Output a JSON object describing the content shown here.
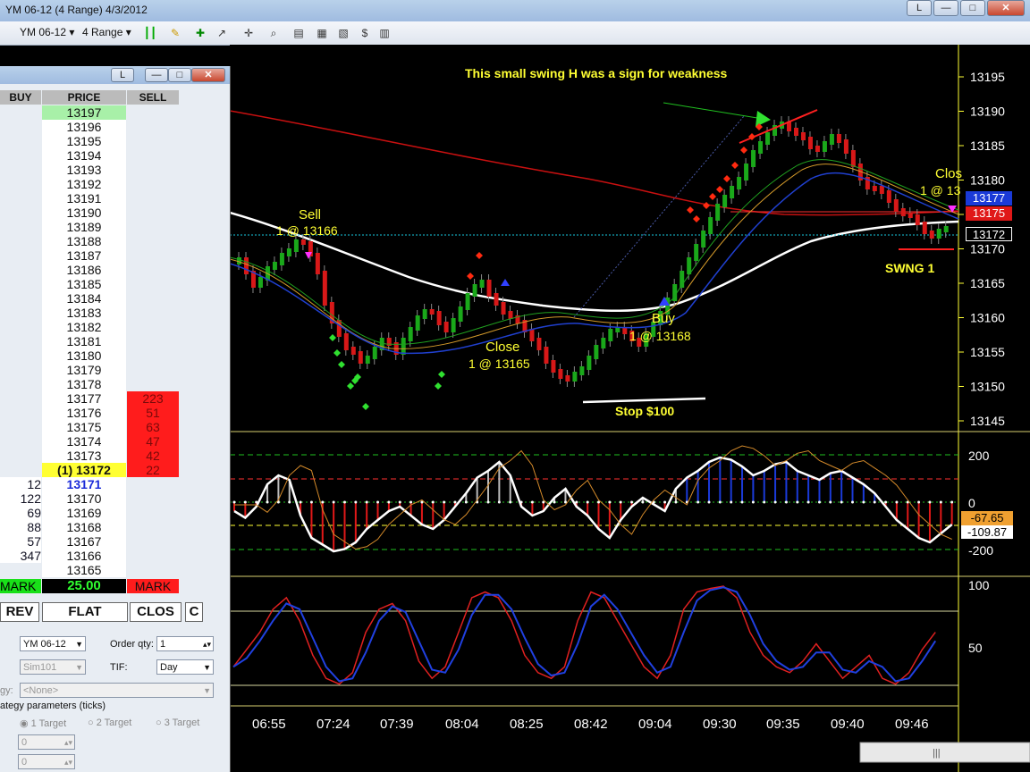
{
  "window": {
    "title": "YM 06-12 (4 Range)  4/3/2012",
    "btn_restore": "L",
    "btn_min": "—",
    "btn_max": "□",
    "btn_close": "✕"
  },
  "toolbar": {
    "instrument": "YM 06-12",
    "period": "4 Range"
  },
  "dom": {
    "title_btn": "L",
    "headers": {
      "buy": "BUY",
      "price": "PRICE",
      "sell": "SELL"
    },
    "rows": [
      {
        "price": "13197",
        "buy": "",
        "sell": ""
      },
      {
        "price": "13196",
        "buy": "",
        "sell": ""
      },
      {
        "price": "13195",
        "buy": "",
        "sell": ""
      },
      {
        "price": "13194",
        "buy": "",
        "sell": ""
      },
      {
        "price": "13193",
        "buy": "",
        "sell": ""
      },
      {
        "price": "13192",
        "buy": "",
        "sell": ""
      },
      {
        "price": "13191",
        "buy": "",
        "sell": ""
      },
      {
        "price": "13190",
        "buy": "",
        "sell": ""
      },
      {
        "price": "13189",
        "buy": "",
        "sell": ""
      },
      {
        "price": "13188",
        "buy": "",
        "sell": ""
      },
      {
        "price": "13187",
        "buy": "",
        "sell": ""
      },
      {
        "price": "13186",
        "buy": "",
        "sell": ""
      },
      {
        "price": "13185",
        "buy": "",
        "sell": ""
      },
      {
        "price": "13184",
        "buy": "",
        "sell": ""
      },
      {
        "price": "13183",
        "buy": "",
        "sell": ""
      },
      {
        "price": "13182",
        "buy": "",
        "sell": ""
      },
      {
        "price": "13181",
        "buy": "",
        "sell": ""
      },
      {
        "price": "13180",
        "buy": "",
        "sell": ""
      },
      {
        "price": "13179",
        "buy": "",
        "sell": ""
      },
      {
        "price": "13178",
        "buy": "",
        "sell": ""
      },
      {
        "price": "13177",
        "buy": "",
        "sell": "223"
      },
      {
        "price": "13176",
        "buy": "",
        "sell": "51"
      },
      {
        "price": "13175",
        "buy": "",
        "sell": "63"
      },
      {
        "price": "13174",
        "buy": "",
        "sell": "47"
      },
      {
        "price": "13173",
        "buy": "",
        "sell": "42"
      },
      {
        "price": "(1) 13172",
        "buy": "",
        "sell": "22"
      },
      {
        "price": "13171",
        "buy": "12",
        "sell": ""
      },
      {
        "price": "13170",
        "buy": "122",
        "sell": ""
      },
      {
        "price": "13169",
        "buy": "69",
        "sell": ""
      },
      {
        "price": "13168",
        "buy": "88",
        "sell": ""
      },
      {
        "price": "13167",
        "buy": "57",
        "sell": ""
      },
      {
        "price": "13166",
        "buy": "347",
        "sell": ""
      },
      {
        "price": "13165",
        "buy": "",
        "sell": ""
      }
    ],
    "mark_left": "MARK",
    "pnl": "25.00",
    "mark_right": "MARK",
    "buttons": {
      "rev": "REV",
      "flat": "FLAT",
      "close": "CLOS",
      "c": "C"
    },
    "form": {
      "instrument": "YM 06-12",
      "order_qty_label": "Order qty:",
      "order_qty": "1",
      "account": "Sim101",
      "tif_label": "TIF:",
      "tif": "Day",
      "strategy_label": "gy:",
      "strategy": "<None>",
      "params_label": "ategy parameters (ticks)",
      "target1": "1 Target",
      "target2": "2 Target",
      "target3": "3 Target",
      "field1": "0",
      "field2": "0"
    }
  },
  "chart": {
    "price_axis": [
      "13195",
      "13190",
      "13185",
      "13180",
      "13175",
      "13170",
      "13165",
      "13160",
      "13155",
      "13150",
      "13145"
    ],
    "annotations": {
      "headline": "This small swing H was a sign for weakness",
      "sell": "Sell",
      "sell_fill": "1 @ 13166",
      "close1": "Close",
      "close1_fill": "1 @ 13165",
      "buy": "Buy",
      "buy_fill": "1 @ 13168",
      "stop": "Stop $100",
      "swing": "SWNG 1",
      "close2": "Clos",
      "close2_fill": "1 @ 13"
    },
    "price_badges": {
      "blue": "13177",
      "red": "13175",
      "white": "13172"
    },
    "osc1_axis": [
      "200",
      "0",
      "-200"
    ],
    "osc1_badges": {
      "orange": "-67.65",
      "white": "-109.87"
    },
    "osc2_axis": [
      "100",
      "50"
    ],
    "time_axis": [
      "06:55",
      "07:24",
      "07:39",
      "08:04",
      "08:25",
      "08:42",
      "09:04",
      "09:30",
      "09:35",
      "09:40",
      "09:46"
    ],
    "colors": {
      "buy": "#19e019",
      "sell": "#ff1c1c",
      "text_yellow": "#ffff33",
      "ma_white": "#ffffff"
    }
  }
}
